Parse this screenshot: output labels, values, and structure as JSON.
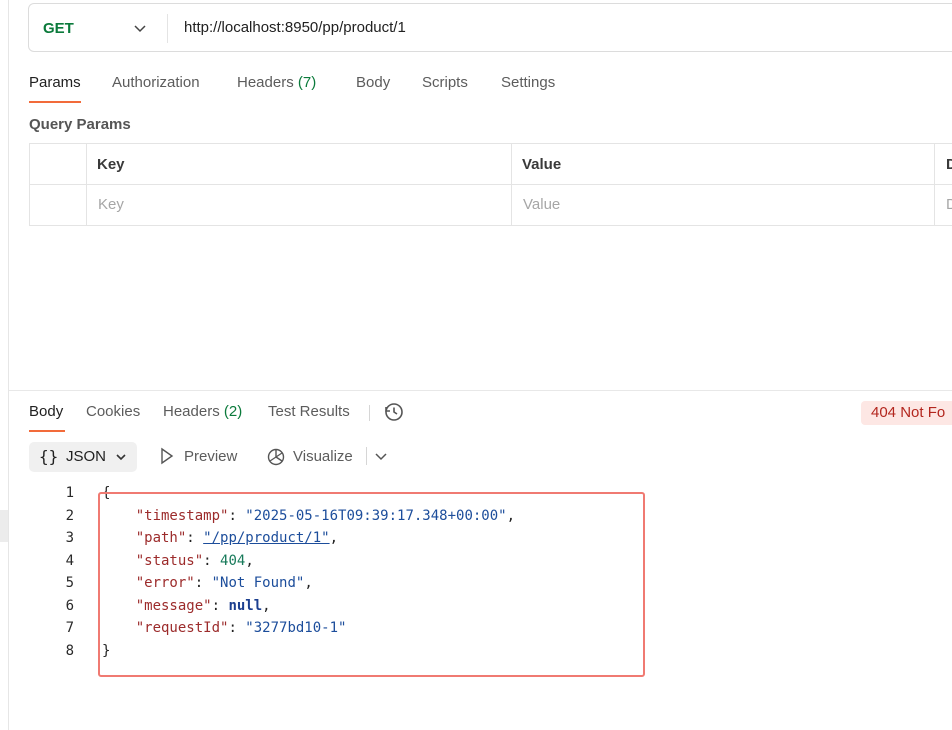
{
  "request": {
    "method": "GET",
    "url": "http://localhost:8950/pp/product/1"
  },
  "request_tabs": [
    {
      "label": "Params",
      "count": ""
    },
    {
      "label": "Authorization",
      "count": ""
    },
    {
      "label": "Headers",
      "count": "(7)"
    },
    {
      "label": "Body",
      "count": ""
    },
    {
      "label": "Scripts",
      "count": ""
    },
    {
      "label": "Settings",
      "count": ""
    }
  ],
  "query_params": {
    "title": "Query Params",
    "columns": [
      "Key",
      "Value",
      "D"
    ],
    "placeholders": {
      "key": "Key",
      "value": "Value",
      "description": "D"
    }
  },
  "response_tabs": [
    {
      "label": "Body",
      "count": ""
    },
    {
      "label": "Cookies",
      "count": ""
    },
    {
      "label": "Headers",
      "count": "(2)"
    },
    {
      "label": "Test Results",
      "count": ""
    }
  ],
  "status": {
    "text": "404 Not Fo",
    "color": "#b3261e"
  },
  "toolbar": {
    "format_label": "JSON",
    "preview_label": "Preview",
    "visualize_label": "Visualize"
  },
  "response_body": {
    "line_numbers": [
      "1",
      "2",
      "3",
      "4",
      "5",
      "6",
      "7",
      "8"
    ],
    "open": "{",
    "close": "}",
    "fields": [
      {
        "key": "\"timestamp\"",
        "value": "\"2025-05-16T09:39:17.348+00:00\"",
        "type": "string",
        "comma": ","
      },
      {
        "key": "\"path\"",
        "value": "\"/pp/product/1\"",
        "type": "link",
        "comma": ","
      },
      {
        "key": "\"status\"",
        "value": "404",
        "type": "number",
        "comma": ","
      },
      {
        "key": "\"error\"",
        "value": "\"Not Found\"",
        "type": "string",
        "comma": ","
      },
      {
        "key": "\"message\"",
        "value": "null",
        "type": "keyword",
        "comma": ","
      },
      {
        "key": "\"requestId\"",
        "value": "\"3277bd10-1\"",
        "type": "string",
        "comma": ""
      }
    ]
  },
  "colors": {
    "accent": "#f26b3a",
    "get_method": "#0b7a3b",
    "highlight_box": "#f07a72"
  }
}
